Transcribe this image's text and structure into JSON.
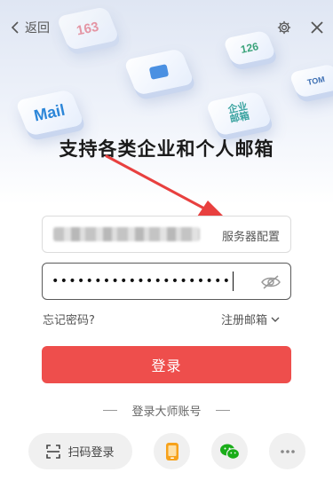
{
  "header": {
    "back_label": "返回",
    "back_icon": "chevron-left-icon",
    "settings_icon": "gear-icon",
    "close_icon": "close-icon"
  },
  "hero": {
    "cards": [
      {
        "name": "163-card",
        "text": "163"
      },
      {
        "name": "126-card",
        "text": "126"
      },
      {
        "name": "tom-card",
        "text": "TOM"
      },
      {
        "name": "mail-card",
        "text": "Mail"
      },
      {
        "name": "qiye-card",
        "text": "企业邮箱"
      }
    ],
    "headline": "支持各类企业和个人邮箱"
  },
  "form": {
    "account_value": "(blurred)",
    "server_config_label": "服务器配置",
    "password_dots": "•••••••••••••••••••••",
    "password_visibility_icon": "eye-off-icon",
    "forgot_password_label": "忘记密码?",
    "register_label": "注册邮箱",
    "login_button_label": "登录",
    "master_login_label": "登录大师账号"
  },
  "footer": {
    "scan_login_label": "扫码登录",
    "scan_icon": "scan-icon",
    "phone_icon": "phone-icon",
    "wechat_icon": "wechat-icon",
    "more_icon": "more-icon"
  },
  "colors": {
    "accent_red": "#ee4e4c",
    "arrow_red": "#e8403f",
    "phone_orange": "#f7a21b",
    "wechat_green": "#1aad19"
  }
}
